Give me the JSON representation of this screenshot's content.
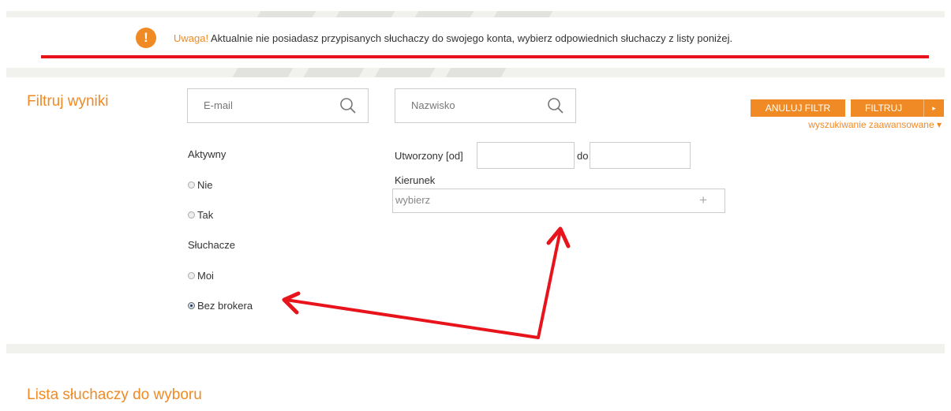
{
  "warning": {
    "label": "Uwaga!",
    "message": "Aktualnie nie posiadasz przypisanych słuchaczy do swojego konta, wybierz odpowiednich słuchaczy z listy poniżej.",
    "icon_glyph": "!",
    "icon": "exclamation-circle-icon"
  },
  "filter": {
    "title": "Filtruj wyniki",
    "email_placeholder": "E-mail",
    "lastname_placeholder": "Nazwisko",
    "active": {
      "label": "Aktywny",
      "options": [
        "Nie",
        "Tak"
      ],
      "selected": null
    },
    "listeners": {
      "label": "Słuchacze",
      "options": [
        "Moi",
        "Bez brokera"
      ],
      "selected": "Bez brokera"
    },
    "created_from_label": "Utworzony [od]",
    "created_to_label": "do",
    "direction_label": "Kierunek",
    "direction_placeholder": "wybierz",
    "direction_add": "+",
    "cancel_label": "ANULUJ FILTR",
    "filter_label": "FILTRUJ",
    "filter_arrow": "▸",
    "advanced_label": "wyszukiwanie zaawansowane",
    "advanced_caret": "▾"
  },
  "list": {
    "title": "Lista słuchaczy do wyboru"
  },
  "colors": {
    "accent": "#f08a24",
    "annotation": "#e8141b"
  }
}
